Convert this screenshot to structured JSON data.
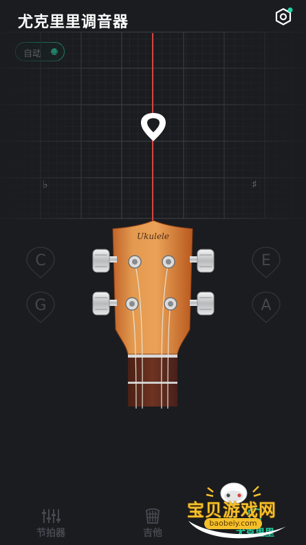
{
  "header": {
    "title": "尤克里里调音器",
    "settings_icon": "gear-icon",
    "notification_color": "#23d3a2"
  },
  "mode": {
    "label": "自动",
    "active": true,
    "accent": "#1fbf95"
  },
  "meter": {
    "flat_symbol": "♭",
    "sharp_symbol": "♯",
    "needle_color": "#d9433f",
    "indicator_icon": "pick-icon"
  },
  "strings": {
    "c": "C",
    "g": "G",
    "e": "E",
    "a": "A"
  },
  "instrument": {
    "brand": "Ukulele"
  },
  "nav": {
    "metronome": "节拍器",
    "guitar": "吉他",
    "ukulele": "尤克里里",
    "active_color": "#23d3a2"
  },
  "watermark": {
    "text": "宝贝游戏网",
    "url": "baobeiy.com"
  }
}
